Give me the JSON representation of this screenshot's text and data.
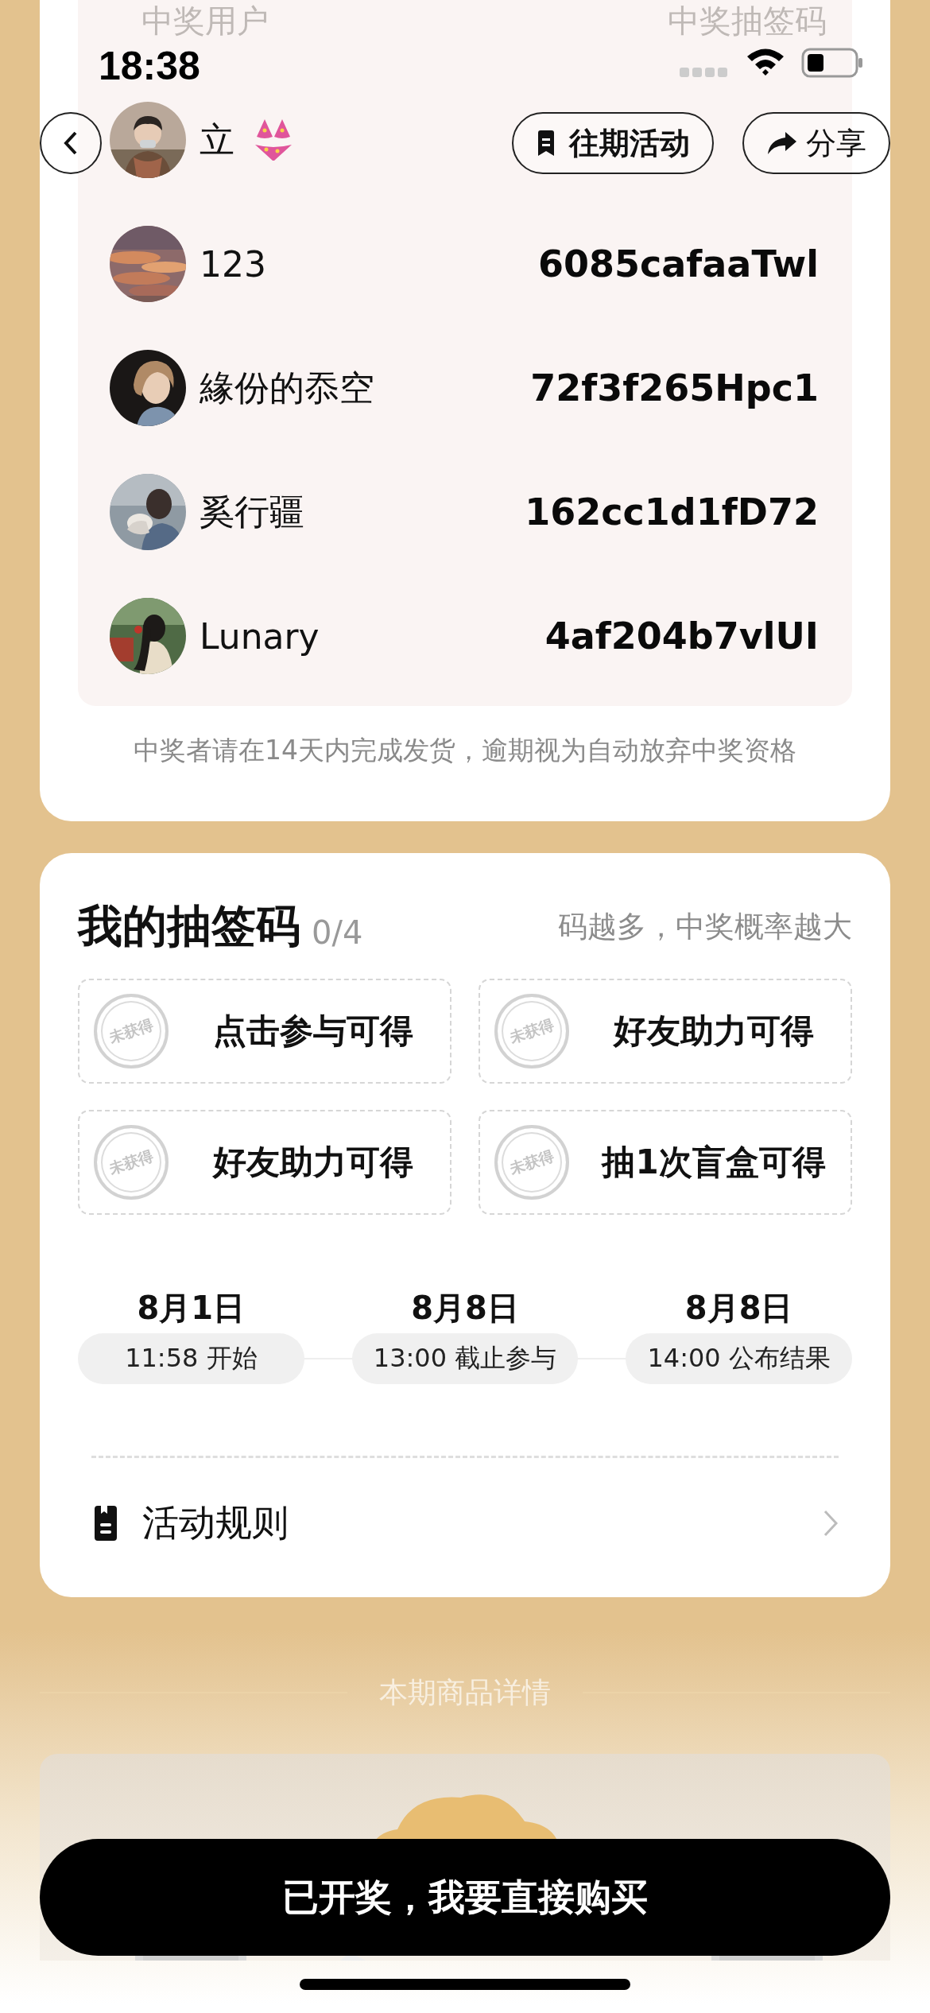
{
  "status_bar": {
    "time": "18:38"
  },
  "nav": {
    "past_button": "往期活动",
    "share_button": "分享"
  },
  "winners": {
    "columns": [
      "中奖用户",
      "中奖抽签码"
    ],
    "rows": [
      {
        "name": "立",
        "emoji": true
      },
      {
        "name": "123",
        "emoji": false,
        "code": "6085cafaaTwl"
      },
      {
        "name": "緣份的忝空",
        "emoji": false,
        "code": "72f3f265Hpc1"
      },
      {
        "name": "奚行疆",
        "emoji": false,
        "code": "162cc1d1fD72"
      },
      {
        "name": "Lunary",
        "emoji": false,
        "code": "4af204b7vlUI"
      }
    ],
    "note": "中奖者请在14天内完成发货，逾期视为自动放弃中奖资格"
  },
  "my_codes": {
    "title": "我的抽签码",
    "count": "0/4",
    "hint": "码越多，中奖概率越大",
    "tickets": [
      {
        "stamp": "未获得",
        "label": "点击参与可得"
      },
      {
        "stamp": "未获得",
        "label": "好友助力可得"
      },
      {
        "stamp": "未获得",
        "label": "好友助力可得"
      },
      {
        "stamp": "未获得",
        "label": "抽1次盲盒可得"
      }
    ],
    "timeline": [
      {
        "date": "8月1日",
        "time": "11:58 开始"
      },
      {
        "date": "8月8日",
        "time": "13:00 截止参与"
      },
      {
        "date": "8月8日",
        "time": "14:00 公布结果"
      }
    ],
    "rules_link": "活动规则"
  },
  "product_section": {
    "title": "本期商品详情"
  },
  "buy_button": "已开奖，我要直接购买"
}
